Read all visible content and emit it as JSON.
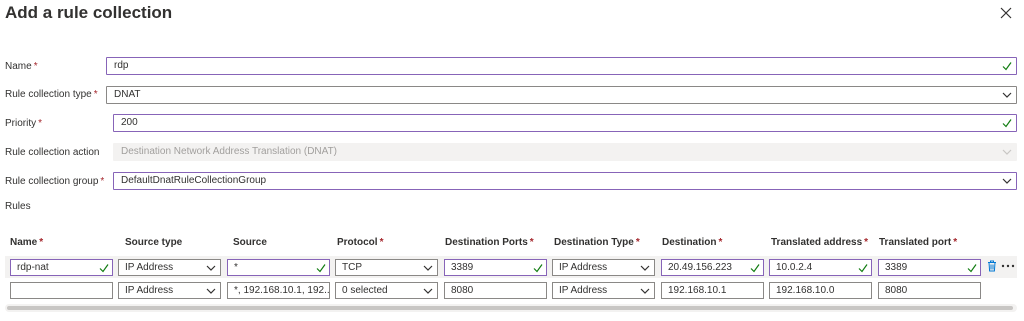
{
  "dialog": {
    "title": "Add a rule collection"
  },
  "form": {
    "name": {
      "label": "Name",
      "required": true,
      "value": "rdp"
    },
    "type": {
      "label": "Rule collection type",
      "required": true,
      "value": "DNAT"
    },
    "priority": {
      "label": "Priority",
      "required": true,
      "value": "200"
    },
    "action": {
      "label": "Rule collection action",
      "required": false,
      "value": "Destination Network Address Translation (DNAT)"
    },
    "group": {
      "label": "Rule collection group",
      "required": true,
      "value": "DefaultDnatRuleCollectionGroup"
    }
  },
  "rules": {
    "label": "Rules",
    "columns": [
      {
        "label": "Name",
        "required": true
      },
      {
        "label": "Source type",
        "required": false
      },
      {
        "label": "Source",
        "required": false
      },
      {
        "label": "Protocol",
        "required": true
      },
      {
        "label": "Destination Ports",
        "required": true
      },
      {
        "label": "Destination Type",
        "required": true
      },
      {
        "label": "Destination",
        "required": true
      },
      {
        "label": "Translated address",
        "required": true
      },
      {
        "label": "Translated port",
        "required": true
      }
    ],
    "rows": [
      {
        "name": "rdp-nat",
        "source_type": "IP Address",
        "source": "*",
        "protocol": "TCP",
        "dest_ports": "3389",
        "dest_type": "IP Address",
        "destination": "20.49.156.223",
        "translated_address": "10.0.2.4",
        "translated_port": "3389"
      },
      {
        "name": "",
        "source_type": "IP Address",
        "source": "*, 192.168.10.1, 192....",
        "protocol": "0 selected",
        "dest_ports": "8080",
        "dest_type": "IP Address",
        "destination": "192.168.10.1",
        "translated_address": "192.168.10.0",
        "translated_port": "8080"
      }
    ]
  },
  "icons": {
    "close": "close-icon",
    "delete": "trash-icon",
    "more": "more-icon",
    "check": "checkmark-icon",
    "chevron": "chevron-down-icon"
  },
  "colors": {
    "valid_border": "#8764b8",
    "check": "#107c10",
    "required": "#a4262c",
    "delete": "#0078d4"
  }
}
